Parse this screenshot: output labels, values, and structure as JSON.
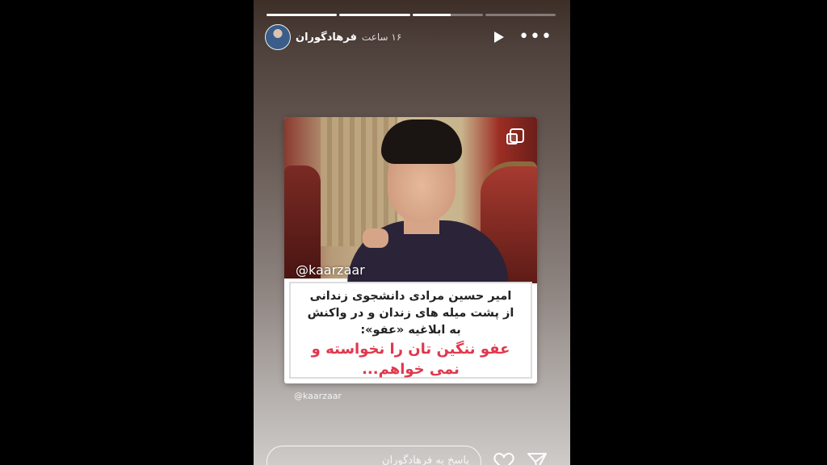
{
  "story": {
    "progress": [
      1.0,
      1.0,
      0.55,
      0.0
    ],
    "user": {
      "name": "فرهادگوران",
      "time": "۱۶ ساعت"
    },
    "icons": {
      "avatar": "avatar",
      "play": "play-icon",
      "more": "more-icon",
      "multi": "multi-post-icon",
      "heart": "heart-icon",
      "send": "send-icon"
    }
  },
  "post": {
    "photo_handle": "@kaarzaar",
    "lines": [
      "امیر حسین مرادی دانشجوی زندانی",
      "از پشت میله های زندان و در واکنش",
      "به ابلاغیه «عفو»:"
    ],
    "red_lines": [
      "عفو ننگین تان را نخواسته و",
      "نمی خواهم..."
    ],
    "handle_below": "@kaarzaar"
  },
  "reply": {
    "placeholder": "پاسخ به فرهادگوران"
  }
}
